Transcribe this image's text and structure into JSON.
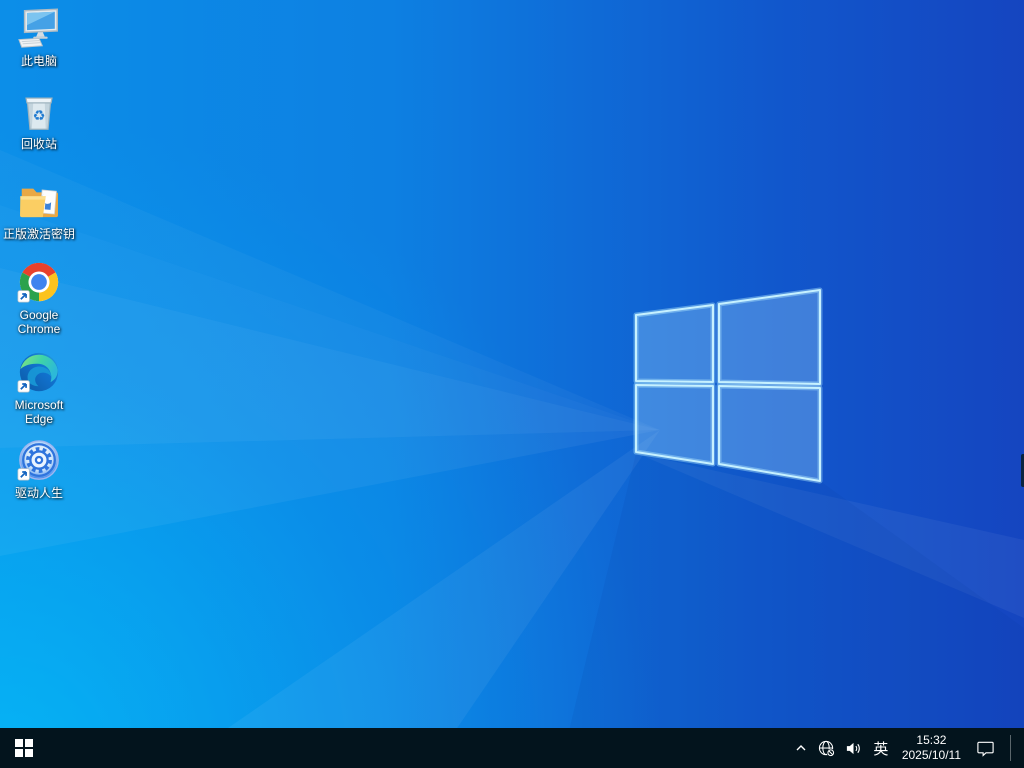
{
  "desktop": {
    "icons": [
      {
        "name": "this-pc",
        "lines": [
          "此电脑"
        ]
      },
      {
        "name": "recycle-bin",
        "lines": [
          "回收站"
        ]
      },
      {
        "name": "activation-key-folder",
        "lines": [
          "正版激活密钥"
        ]
      },
      {
        "name": "google-chrome",
        "lines": [
          "Google",
          "Chrome"
        ]
      },
      {
        "name": "microsoft-edge",
        "lines": [
          "Microsoft",
          "Edge"
        ]
      },
      {
        "name": "driver-life",
        "lines": [
          "驱动人生"
        ]
      }
    ]
  },
  "taskbar": {
    "ime_label": "英",
    "clock": {
      "time": "15:32",
      "date": "2025/10/11"
    },
    "icons": {
      "start": "windows-logo",
      "hidden_icons": "chevron-up",
      "network": "globe-offline",
      "volume": "speaker-waves",
      "action_center": "speech-bubble"
    },
    "colors": {
      "taskbar_bg": "#03141d",
      "icon_fg": "#ffffff"
    }
  },
  "wallpaper": {
    "colors": {
      "bottom_left": "#00b2f6",
      "top_left": "#0f8ae4",
      "right": "#1545c0",
      "logo_stroke": "#c6f1ff"
    }
  }
}
